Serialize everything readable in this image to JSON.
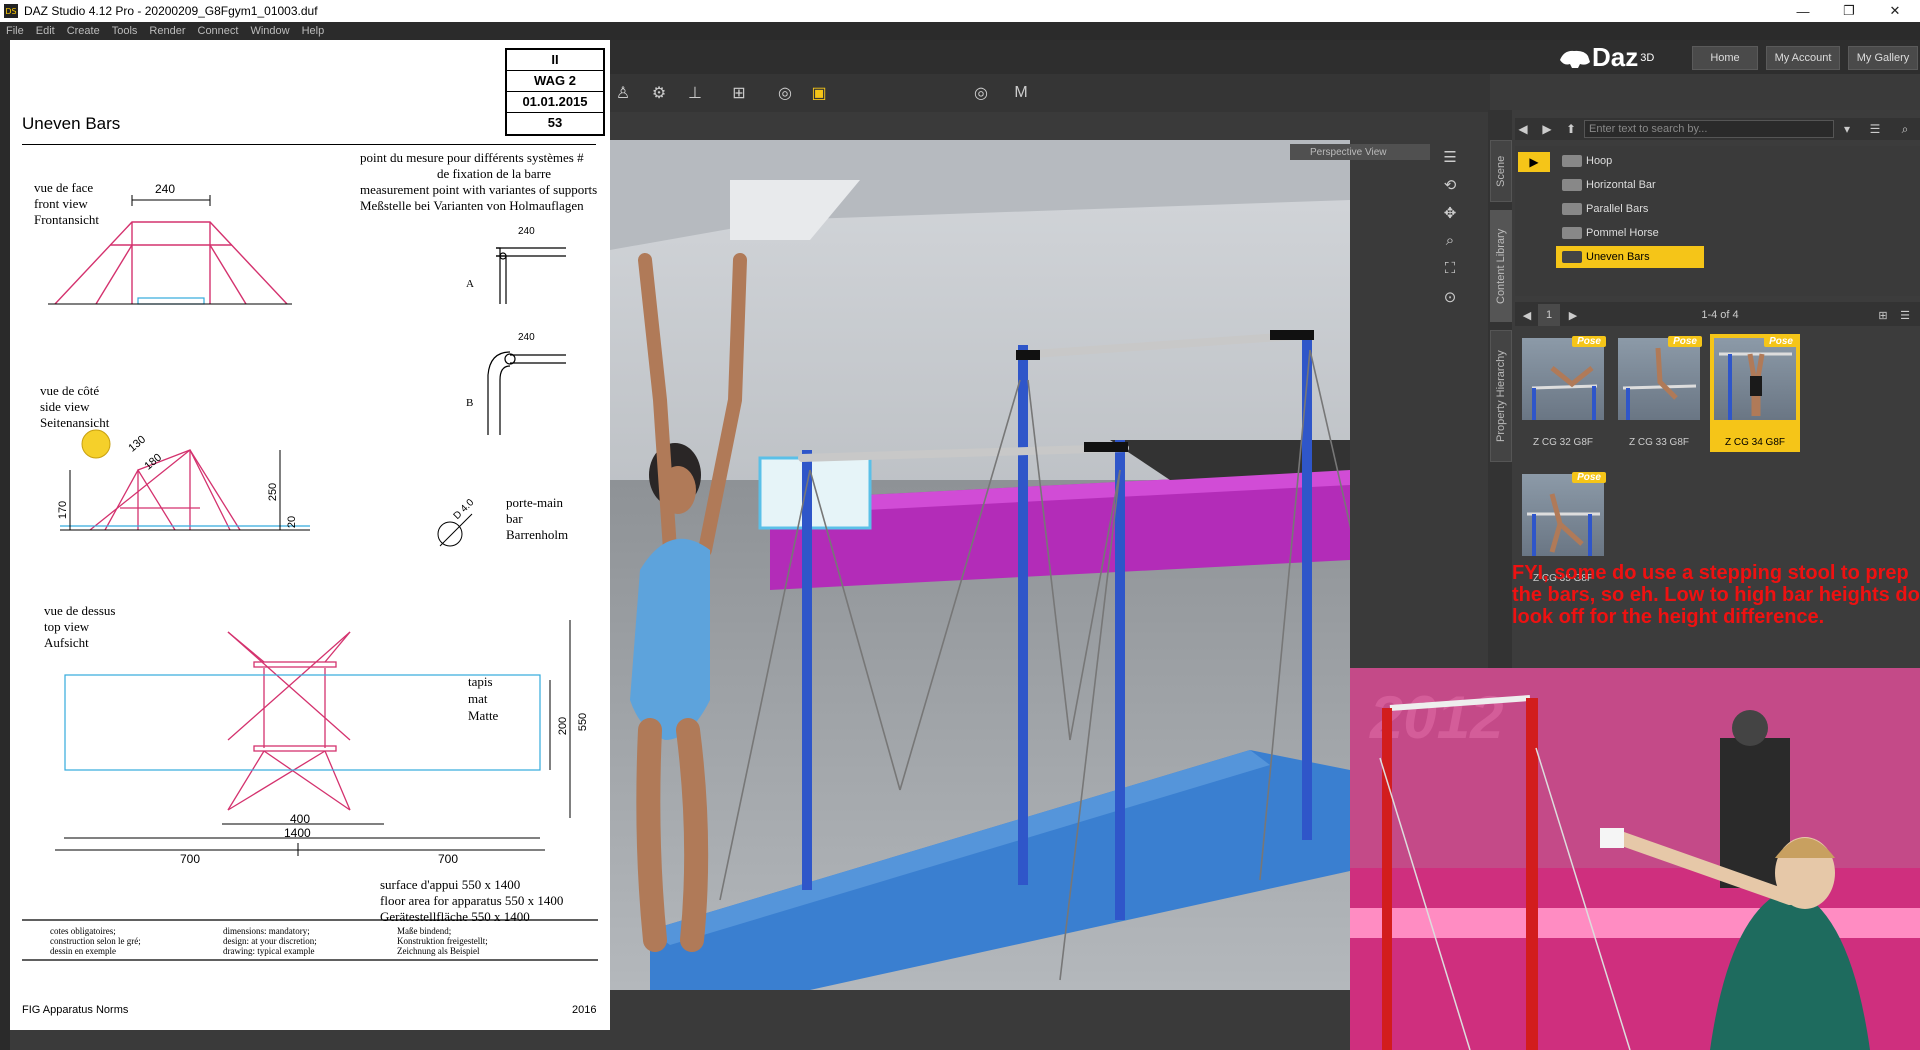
{
  "window": {
    "title": "DAZ Studio 4.12 Pro - 20200209_G8Fgym1_01003.duf",
    "app_icon": "DS",
    "controls": [
      "—",
      "❐",
      "✕"
    ]
  },
  "menu": [
    "File",
    "Edit",
    "Create",
    "Tools",
    "Render",
    "Connect",
    "Window",
    "Help"
  ],
  "header": {
    "brand": "Daz",
    "brand_sup": "3D",
    "nav": [
      "Home",
      "My Account",
      "My Gallery"
    ]
  },
  "viewport": {
    "label": "Perspective View"
  },
  "panel": {
    "tabs": [
      "Scene",
      "Content Library",
      "Property Hierarchy"
    ],
    "search_placeholder": "Enter text to search by...",
    "folders": [
      "Hoop",
      "Horizontal Bar",
      "Parallel Bars",
      "Pommel Horse",
      "Uneven Bars"
    ],
    "selected_folder": "Uneven Bars",
    "page_number": "1",
    "page_range": "1-4 of 4",
    "assets": [
      {
        "label": "Z CG 32 G8F",
        "badge": "Pose"
      },
      {
        "label": "Z CG 33 G8F",
        "badge": "Pose"
      },
      {
        "label": "Z CG 34 G8F",
        "badge": "Pose"
      },
      {
        "label": "Z CG 35 G8F",
        "badge": "Pose"
      }
    ],
    "selected_asset": "Z CG 34 G8F"
  },
  "note": {
    "text": "FYI, some do use a stepping stool to prep the bars, so eh. Low to high bar heights do look off for the height difference."
  },
  "document": {
    "title": "Uneven Bars",
    "info": [
      "II",
      "WAG 2",
      "01.01.2015",
      "53"
    ],
    "measure_point": [
      "point du mesure pour différents systèmes #",
      "de fixation de la barre",
      "measurement point with variantes of supports",
      "Meßstelle bei Varianten von Holmauflagen"
    ],
    "front_view": [
      "vue de face",
      "front view",
      "Frontansicht"
    ],
    "side_view": [
      "vue de côté",
      "side view",
      "Seitenansicht"
    ],
    "top_view": [
      "vue de dessus",
      "top view",
      "Aufsicht"
    ],
    "handrail": [
      "porte-main",
      "bar",
      "Barrenholm"
    ],
    "mat": [
      "tapis",
      "mat",
      "Matte"
    ],
    "floor_area": [
      "surface d'appui 550 x 1400",
      "floor area for apparatus 550 x 1400",
      "Gerätestellfläche 550 x 1400"
    ],
    "dims": {
      "front_width": "240",
      "a_dim": "240",
      "b_dim": "240",
      "side_130": "130",
      "side_180": "180",
      "side_250": "250",
      "side_170": "170",
      "side_20": "20",
      "diameter": "D 4.0",
      "top_200": "200",
      "top_550": "550",
      "top_400": "400",
      "top_1400": "1400",
      "left_700": "700",
      "right_700": "700",
      "label_a": "A",
      "label_b": "B"
    },
    "footer_fr": [
      "cotes obligatoires;",
      "construction selon le gré;",
      "dessin en exemple"
    ],
    "footer_en": [
      "dimensions: mandatory;",
      "design: at your discretion;",
      "drawing: typical example"
    ],
    "footer_de": [
      "Maße bindend;",
      "Konstruktion freigestellt;",
      "Zeichnung als Beispiel"
    ],
    "source": "FIG Apparatus Norms",
    "year": "2016"
  },
  "colors": {
    "accent": "#f5c518",
    "note_red": "#ee1111",
    "diagram_pink": "#d4326e",
    "diagram_cyan": "#33aadd",
    "bar_blue": "#2f56c9",
    "mat_blue": "#3a7fd0"
  }
}
